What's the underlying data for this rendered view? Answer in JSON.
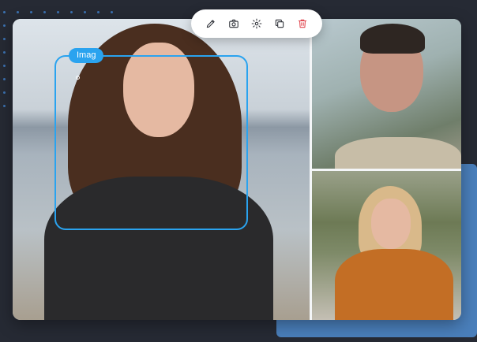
{
  "toolbar": {
    "tools": [
      {
        "name": "edit",
        "icon": "pencil-icon"
      },
      {
        "name": "capture",
        "icon": "camera-icon"
      },
      {
        "name": "settings",
        "icon": "gear-icon"
      },
      {
        "name": "duplicate",
        "icon": "copy-icon"
      },
      {
        "name": "delete",
        "icon": "trash-icon"
      }
    ]
  },
  "selection": {
    "label": "Imag"
  },
  "colors": {
    "background": "#262a34",
    "accent_panel": "#4a7fbb",
    "selection": "#2aa3ef",
    "delete": "#e0444d"
  }
}
